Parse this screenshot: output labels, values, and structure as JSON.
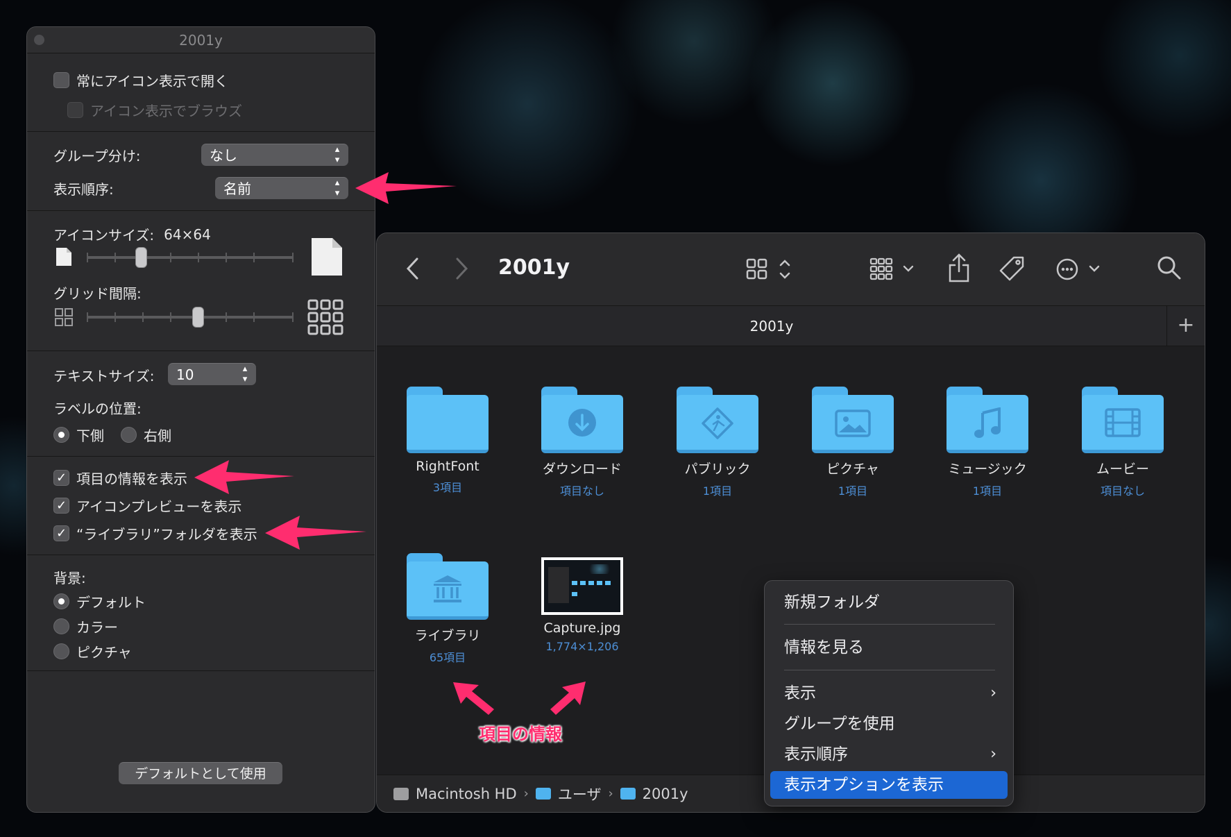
{
  "options_panel": {
    "title": "2001y",
    "always_open_icon_view": {
      "label": "常にアイコン表示で開く",
      "checked": false
    },
    "browse_icon_view": {
      "label": "アイコン表示でブラウズ",
      "checked": false,
      "disabled": true
    },
    "group_by": {
      "label": "グループ分け:",
      "value": "なし"
    },
    "sort_by": {
      "label": "表示順序:",
      "value": "名前"
    },
    "icon_size": {
      "label": "アイコンサイズ:",
      "value": "64×64",
      "slider_fraction": 0.25
    },
    "grid_spacing": {
      "label": "グリッド間隔:",
      "slider_fraction": 0.54
    },
    "text_size": {
      "label": "テキストサイズ:",
      "value": "10"
    },
    "label_position": {
      "label": "ラベルの位置:",
      "options": [
        "下側",
        "右側"
      ],
      "selected": "下側"
    },
    "show_item_info": {
      "label": "項目の情報を表示",
      "checked": true
    },
    "show_icon_preview": {
      "label": "アイコンプレビューを表示",
      "checked": true
    },
    "show_library_folder": {
      "label": "“ライブラリ”フォルダを表示",
      "checked": true
    },
    "background": {
      "label": "背景:",
      "options": [
        "デフォルト",
        "カラー",
        "ピクチャ"
      ],
      "selected": "デフォルト"
    },
    "use_as_defaults": "デフォルトとして使用"
  },
  "finder": {
    "title": "2001y",
    "tab_label": "2001y",
    "toolbar_icons": [
      "back-icon",
      "forward-icon",
      "icon-view-icon",
      "group-icon",
      "share-icon",
      "tag-icon",
      "more-icon",
      "search-icon"
    ],
    "items": [
      {
        "name": "RightFont",
        "info": "3項目",
        "icon": "folder"
      },
      {
        "name": "ダウンロード",
        "info": "項目なし",
        "icon": "downloads-folder",
        "glyph": "⬇"
      },
      {
        "name": "パブリック",
        "info": "1項目",
        "icon": "public-folder",
        "glyph": "◇"
      },
      {
        "name": "ピクチャ",
        "info": "1項目",
        "icon": "pictures-folder",
        "glyph": "▣"
      },
      {
        "name": "ミュージック",
        "info": "1項目",
        "icon": "music-folder",
        "glyph": "♫"
      },
      {
        "name": "ムービー",
        "info": "項目なし",
        "icon": "movies-folder",
        "glyph": "▤"
      },
      {
        "name": "ライブラリ",
        "info": "65項目",
        "icon": "library-folder",
        "glyph": "⌂"
      },
      {
        "name": "Capture.jpg",
        "info": "1,774×1,206",
        "icon": "image-thumbnail"
      }
    ],
    "path": [
      "Macintosh HD",
      "ユーザ",
      "2001y"
    ]
  },
  "context_menu": {
    "items": [
      "新規フォルダ",
      "情報を見る",
      "表示",
      "グループを使用",
      "表示順序",
      "表示オプションを表示"
    ],
    "selected": "表示オプションを表示"
  },
  "annotations": {
    "item_info_label": "項目の情報",
    "accent_color": "#ff2d6f"
  },
  "colors": {
    "folder_blue": "#5cc1f7",
    "info_blue": "#4d8fd6",
    "menu_highlight": "#1c67d4"
  }
}
